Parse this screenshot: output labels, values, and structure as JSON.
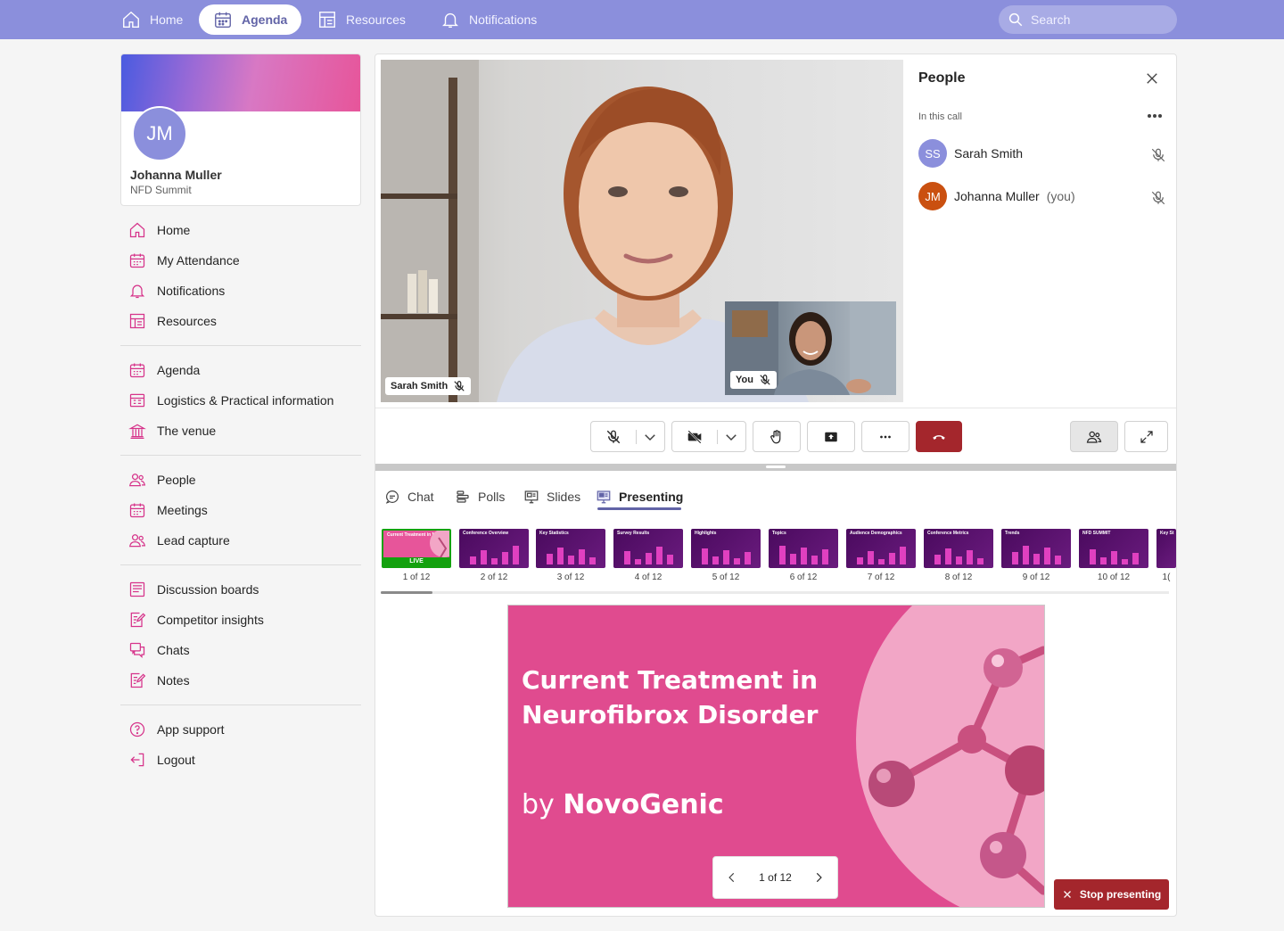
{
  "topnav": {
    "items": [
      {
        "label": "Home",
        "icon": "home-icon"
      },
      {
        "label": "Agenda",
        "icon": "calendar-icon",
        "active": true
      },
      {
        "label": "Resources",
        "icon": "resources-icon"
      },
      {
        "label": "Notifications",
        "icon": "bell-icon"
      }
    ],
    "search_placeholder": "Search"
  },
  "profile": {
    "initials": "JM",
    "name": "Johanna Muller",
    "org": "NFD Summit"
  },
  "sidebar": {
    "items": [
      {
        "label": "Home",
        "icon": "home-icon"
      },
      {
        "label": "My Attendance",
        "icon": "calendar-icon"
      },
      {
        "label": "Notifications",
        "icon": "bell-icon"
      },
      {
        "label": "Resources",
        "icon": "resources-icon"
      },
      {
        "label": "Agenda",
        "icon": "calendar-icon"
      },
      {
        "label": "Logistics & Practical information",
        "icon": "info-board-icon"
      },
      {
        "label": "The venue",
        "icon": "building-icon"
      },
      {
        "label": "People",
        "icon": "people-icon"
      },
      {
        "label": "Meetings",
        "icon": "calendar-icon"
      },
      {
        "label": "Lead capture",
        "icon": "people-icon"
      },
      {
        "label": "Discussion boards",
        "icon": "board-icon"
      },
      {
        "label": "Competitor insights",
        "icon": "note-edit-icon"
      },
      {
        "label": "Chats",
        "icon": "chat-icon"
      },
      {
        "label": "Notes",
        "icon": "note-edit-icon"
      },
      {
        "label": "App support",
        "icon": "question-icon"
      },
      {
        "label": "Logout",
        "icon": "logout-icon"
      }
    ]
  },
  "video": {
    "main_label": "Sarah Smith",
    "self_label": "You"
  },
  "people_panel": {
    "title": "People",
    "section": "In this call",
    "participants": [
      {
        "initials": "SS",
        "name": "Sarah Smith",
        "suffix": "",
        "color": "#8b8fdc"
      },
      {
        "initials": "JM",
        "name": "Johanna Muller",
        "suffix": "(you)",
        "color": "#ca5010"
      }
    ]
  },
  "tabs": [
    {
      "label": "Chat",
      "icon": "chat-icon"
    },
    {
      "label": "Polls",
      "icon": "polls-icon"
    },
    {
      "label": "Slides",
      "icon": "slides-icon"
    },
    {
      "label": "Presenting",
      "icon": "presenting-icon",
      "active": true
    }
  ],
  "thumbnails": [
    {
      "title": "Current Treatment in Neurofibrox Disorder",
      "caption": "1 of 12",
      "live": true
    },
    {
      "title": "Conference Overview",
      "caption": "2 of 12"
    },
    {
      "title": "Key Statistics",
      "caption": "3 of 12"
    },
    {
      "title": "Survey Results",
      "caption": "4 of 12"
    },
    {
      "title": "Highlights",
      "caption": "5 of 12"
    },
    {
      "title": "Topics",
      "caption": "6 of 12"
    },
    {
      "title": "Audience Demographics",
      "caption": "7 of 12"
    },
    {
      "title": "Conference Metrics",
      "caption": "8 of 12"
    },
    {
      "title": "Trends",
      "caption": "9 of 12"
    },
    {
      "title": "NFD SUMMIT",
      "caption": "10  of 12"
    },
    {
      "title": "Key St",
      "caption": "1("
    }
  ],
  "live_label": "LIVE",
  "slide": {
    "title": "Current Treatment in Neurofibrox Disorder",
    "by": "by",
    "company": "NovoGenic",
    "pager": "1 of 12"
  },
  "stop_presenting": "Stop presenting",
  "colors": {
    "accent": "#6264a7",
    "topbar": "#8b8fdc",
    "danger": "#a4262c",
    "sidebar_icon": "#d6338a"
  }
}
